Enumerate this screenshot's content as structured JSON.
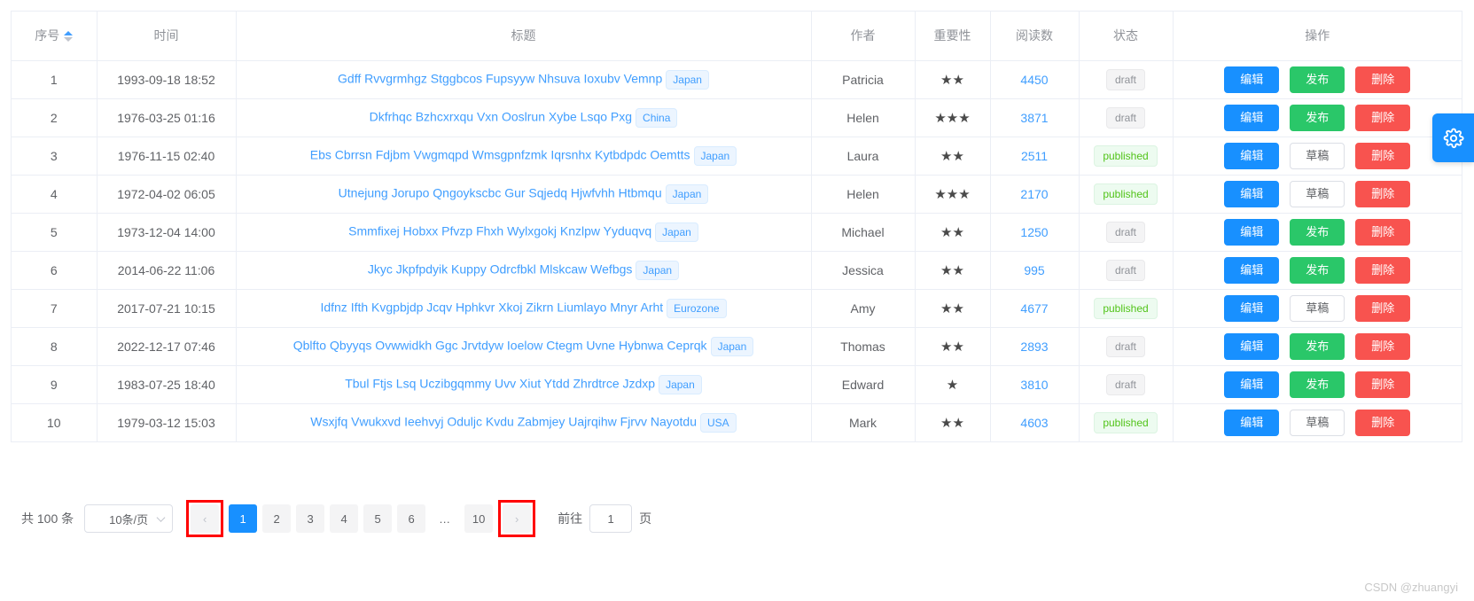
{
  "table": {
    "columns": [
      {
        "key": "index",
        "label": "序号",
        "sortable": true
      },
      {
        "key": "time",
        "label": "时间",
        "sortable": false
      },
      {
        "key": "title",
        "label": "标题",
        "sortable": false
      },
      {
        "key": "author",
        "label": "作者",
        "sortable": false
      },
      {
        "key": "importance",
        "label": "重要性",
        "sortable": false
      },
      {
        "key": "reads",
        "label": "阅读数",
        "sortable": false
      },
      {
        "key": "status",
        "label": "状态",
        "sortable": false
      },
      {
        "key": "ops",
        "label": "操作",
        "sortable": false
      }
    ],
    "sort": {
      "column": "序号",
      "direction": "asc",
      "asc_color": "#409eff",
      "desc_color": "#c0c4cc"
    },
    "rows": [
      {
        "index": "1",
        "time": "1993-09-18 18:52",
        "title": "Gdff Rvvgrmhgz Stggbcos Fupsyyw Nhsuva Ioxubv Vemnp",
        "tag": "Japan",
        "author": "Patricia",
        "stars": 2,
        "reads": "4450",
        "status": "draft",
        "status_type": "draft",
        "actions": [
          {
            "label": "编辑",
            "type": "edit"
          },
          {
            "label": "发布",
            "type": "publish"
          },
          {
            "label": "删除",
            "type": "delete"
          }
        ]
      },
      {
        "index": "2",
        "time": "1976-03-25 01:16",
        "title": "Dkfrhqc Bzhcxrxqu Vxn Ooslrun Xybe Lsqo Pxg",
        "tag": "China",
        "author": "Helen",
        "stars": 3,
        "reads": "3871",
        "status": "draft",
        "status_type": "draft",
        "actions": [
          {
            "label": "编辑",
            "type": "edit"
          },
          {
            "label": "发布",
            "type": "publish"
          },
          {
            "label": "删除",
            "type": "delete"
          }
        ]
      },
      {
        "index": "3",
        "time": "1976-11-15 02:40",
        "title": "Ebs Cbrrsn Fdjbm Vwgmqpd Wmsgpnfzmk Iqrsnhx Kytbdpdc Oemtts",
        "tag": "Japan",
        "author": "Laura",
        "stars": 2,
        "reads": "2511",
        "status": "published",
        "status_type": "published",
        "actions": [
          {
            "label": "编辑",
            "type": "edit"
          },
          {
            "label": "草稿",
            "type": "draft"
          },
          {
            "label": "删除",
            "type": "delete"
          }
        ]
      },
      {
        "index": "4",
        "time": "1972-04-02 06:05",
        "title": "Utnejung Jorupo Qngoykscbc Gur Sqjedq Hjwfvhh Htbmqu",
        "tag": "Japan",
        "author": "Helen",
        "stars": 3,
        "reads": "2170",
        "status": "published",
        "status_type": "published",
        "actions": [
          {
            "label": "编辑",
            "type": "edit"
          },
          {
            "label": "草稿",
            "type": "draft"
          },
          {
            "label": "删除",
            "type": "delete"
          }
        ]
      },
      {
        "index": "5",
        "time": "1973-12-04 14:00",
        "title": "Smmfixej Hobxx Pfvzp Fhxh Wylxgokj Knzlpw Yyduqvq",
        "tag": "Japan",
        "author": "Michael",
        "stars": 2,
        "reads": "1250",
        "status": "draft",
        "status_type": "draft",
        "actions": [
          {
            "label": "编辑",
            "type": "edit"
          },
          {
            "label": "发布",
            "type": "publish"
          },
          {
            "label": "删除",
            "type": "delete"
          }
        ]
      },
      {
        "index": "6",
        "time": "2014-06-22 11:06",
        "title": "Jkyc Jkpfpdyik Kuppy Odrcfbkl Mlskcaw Wefbgs",
        "tag": "Japan",
        "author": "Jessica",
        "stars": 2,
        "reads": "995",
        "status": "draft",
        "status_type": "draft",
        "actions": [
          {
            "label": "编辑",
            "type": "edit"
          },
          {
            "label": "发布",
            "type": "publish"
          },
          {
            "label": "删除",
            "type": "delete"
          }
        ]
      },
      {
        "index": "7",
        "time": "2017-07-21 10:15",
        "title": "Idfnz Ifth Kvgpbjdp Jcqv Hphkvr Xkoj Zikrn Liumlayo Mnyr Arht",
        "tag": "Eurozone",
        "author": "Amy",
        "stars": 2,
        "reads": "4677",
        "status": "published",
        "status_type": "published",
        "actions": [
          {
            "label": "编辑",
            "type": "edit"
          },
          {
            "label": "草稿",
            "type": "draft"
          },
          {
            "label": "删除",
            "type": "delete"
          }
        ]
      },
      {
        "index": "8",
        "time": "2022-12-17 07:46",
        "title": "Qblfto Qbyyqs Ovwwidkh Ggc Jrvtdyw Ioelow Ctegm Uvne Hybnwa Ceprqk",
        "tag": "Japan",
        "author": "Thomas",
        "stars": 2,
        "reads": "2893",
        "status": "draft",
        "status_type": "draft",
        "actions": [
          {
            "label": "编辑",
            "type": "edit"
          },
          {
            "label": "发布",
            "type": "publish"
          },
          {
            "label": "删除",
            "type": "delete"
          }
        ]
      },
      {
        "index": "9",
        "time": "1983-07-25 18:40",
        "title": "Tbul Ftjs Lsq Uczibgqmmy Uvv Xiut Ytdd Zhrdtrce Jzdxp",
        "tag": "Japan",
        "author": "Edward",
        "stars": 1,
        "reads": "3810",
        "status": "draft",
        "status_type": "draft",
        "actions": [
          {
            "label": "编辑",
            "type": "edit"
          },
          {
            "label": "发布",
            "type": "publish"
          },
          {
            "label": "删除",
            "type": "delete"
          }
        ]
      },
      {
        "index": "10",
        "time": "1979-03-12 15:03",
        "title": "Wsxjfq Vwukxvd Ieehvyj Oduljc Kvdu Zabmjey Uajrqihw Fjrvv Nayotdu",
        "tag": "USA",
        "author": "Mark",
        "stars": 2,
        "reads": "4603",
        "status": "published",
        "status_type": "published",
        "actions": [
          {
            "label": "编辑",
            "type": "edit"
          },
          {
            "label": "草稿",
            "type": "draft"
          },
          {
            "label": "删除",
            "type": "delete"
          }
        ]
      }
    ]
  },
  "pagination": {
    "total_label": "共 100 条",
    "page_size_label": "10条/页",
    "prev_icon": "chevron-left-icon",
    "next_icon": "chevron-right-icon",
    "pages": [
      "1",
      "2",
      "3",
      "4",
      "5",
      "6",
      "…",
      "10"
    ],
    "current_page": "1",
    "jump_label": "前往",
    "jump_value": "1",
    "jump_suffix": "页",
    "highlight_color": "#ff0000",
    "highlighted": [
      "prev-arrow",
      "next-arrow"
    ]
  },
  "floating": {
    "gear_icon": "gear-icon",
    "gear_color": "#1890ff"
  },
  "watermark": "CSDN @zhuangyi",
  "colors": {
    "link": "#409eff",
    "primary": "#1890ff",
    "success": "#2ac769",
    "danger": "#f8534f",
    "published_text": "#52c41a",
    "draft_text": "#909399",
    "tag_bg": "#ecf5ff",
    "border": "#ebeef5"
  }
}
